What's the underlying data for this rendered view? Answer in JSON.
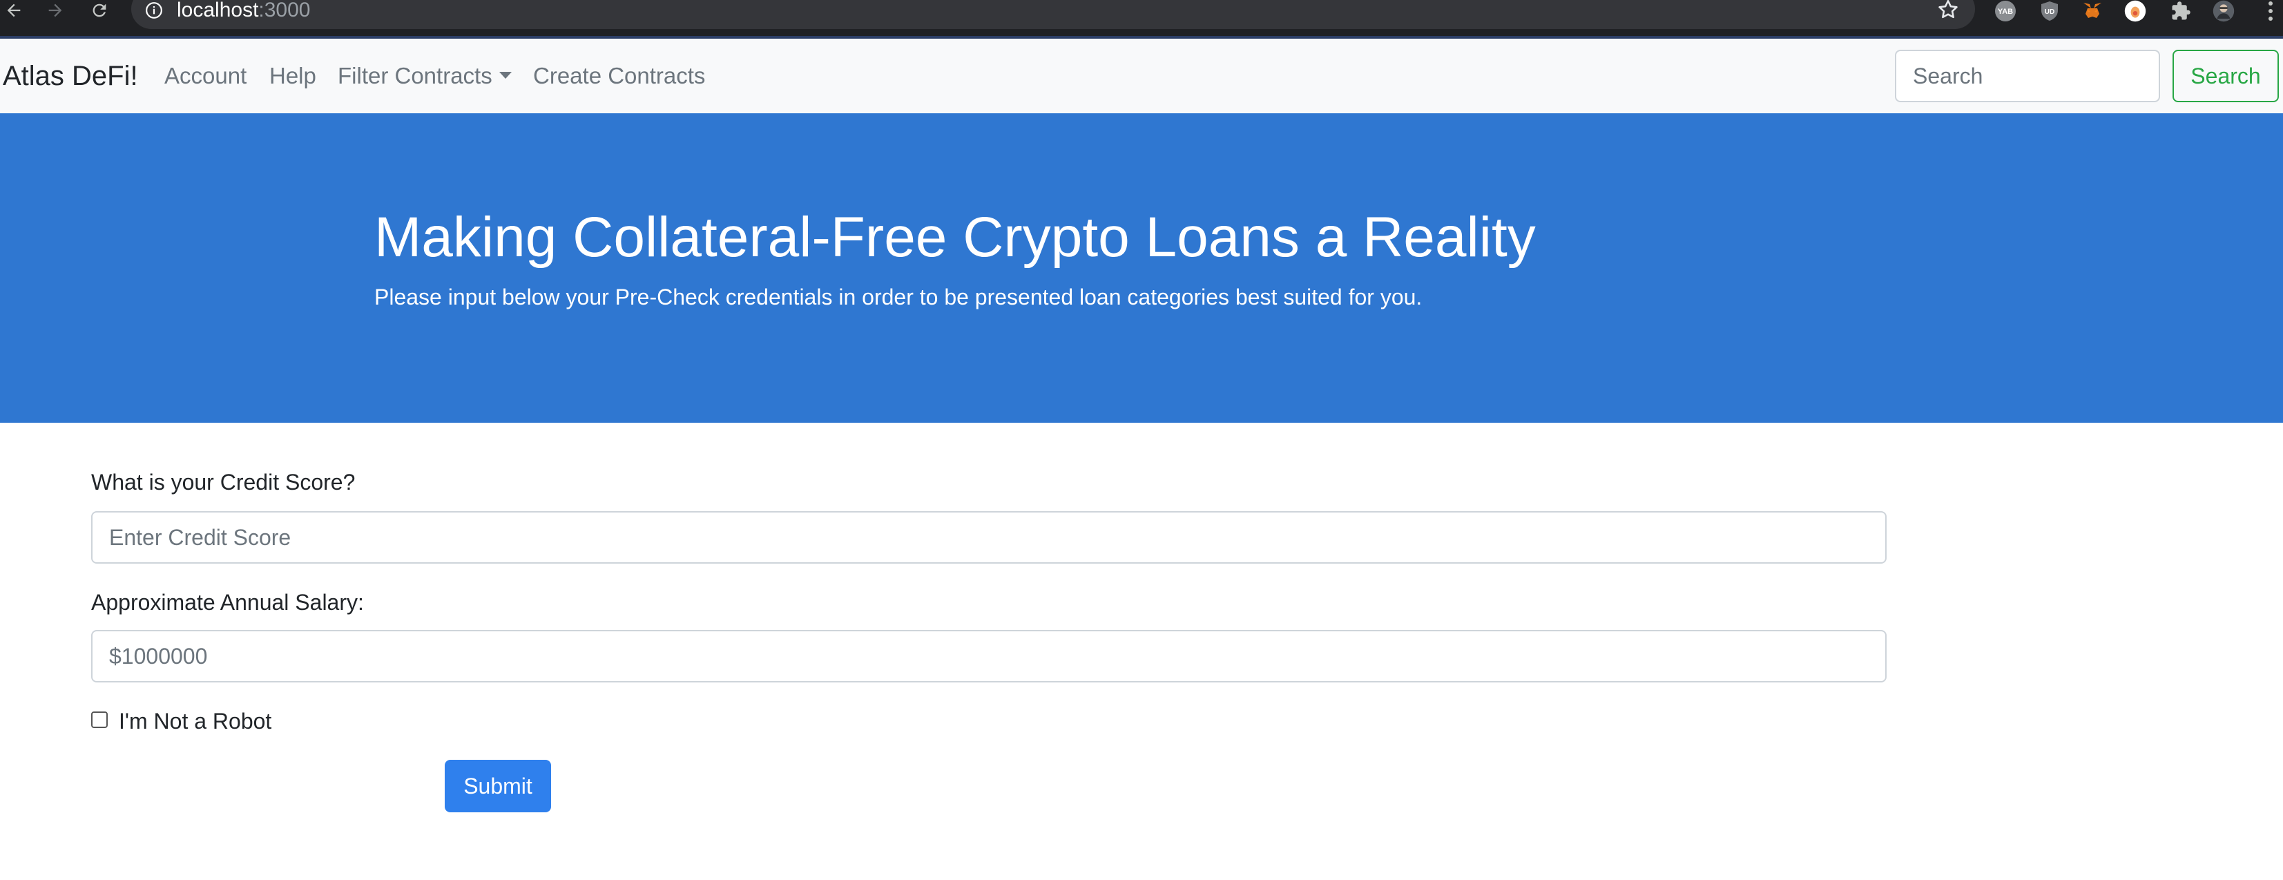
{
  "browser": {
    "url_host": "localhost",
    "url_port": ":3000",
    "icons": [
      "back-icon",
      "forward-icon",
      "reload-icon",
      "info-icon",
      "star-icon",
      "yab-extension-icon",
      "ublock-extension-icon",
      "metamask-extension-icon",
      "wallet-extension-icon",
      "puzzle-extensions-icon",
      "profile-avatar-icon",
      "kebab-menu-icon"
    ],
    "ext_yab_label": "YAB",
    "ext_ublock_label": "UD"
  },
  "navbar": {
    "brand": "Atlas DeFi!",
    "links": [
      "Account",
      "Help",
      "Filter Contracts",
      "Create Contracts"
    ],
    "search_placeholder": "Search",
    "search_button": "Search"
  },
  "hero": {
    "title": "Making Collateral-Free Crypto Loans a Reality",
    "lead": "Please input below your Pre-Check credentials in order to be presented loan categories best suited for you."
  },
  "form": {
    "credit_label": "What is your Credit Score?",
    "credit_placeholder": "Enter Credit Score",
    "salary_label": "Approximate Annual Salary:",
    "salary_placeholder": "$1000000",
    "robot_label": "I'm Not a Robot",
    "robot_checked": false,
    "submit_label": "Submit"
  },
  "colors": {
    "hero_bg": "#2f77d1",
    "navbar_bg": "#f8f9fa",
    "search_button": "#28a745",
    "submit_button": "#2f80ed",
    "chrome_bg": "#202124"
  }
}
